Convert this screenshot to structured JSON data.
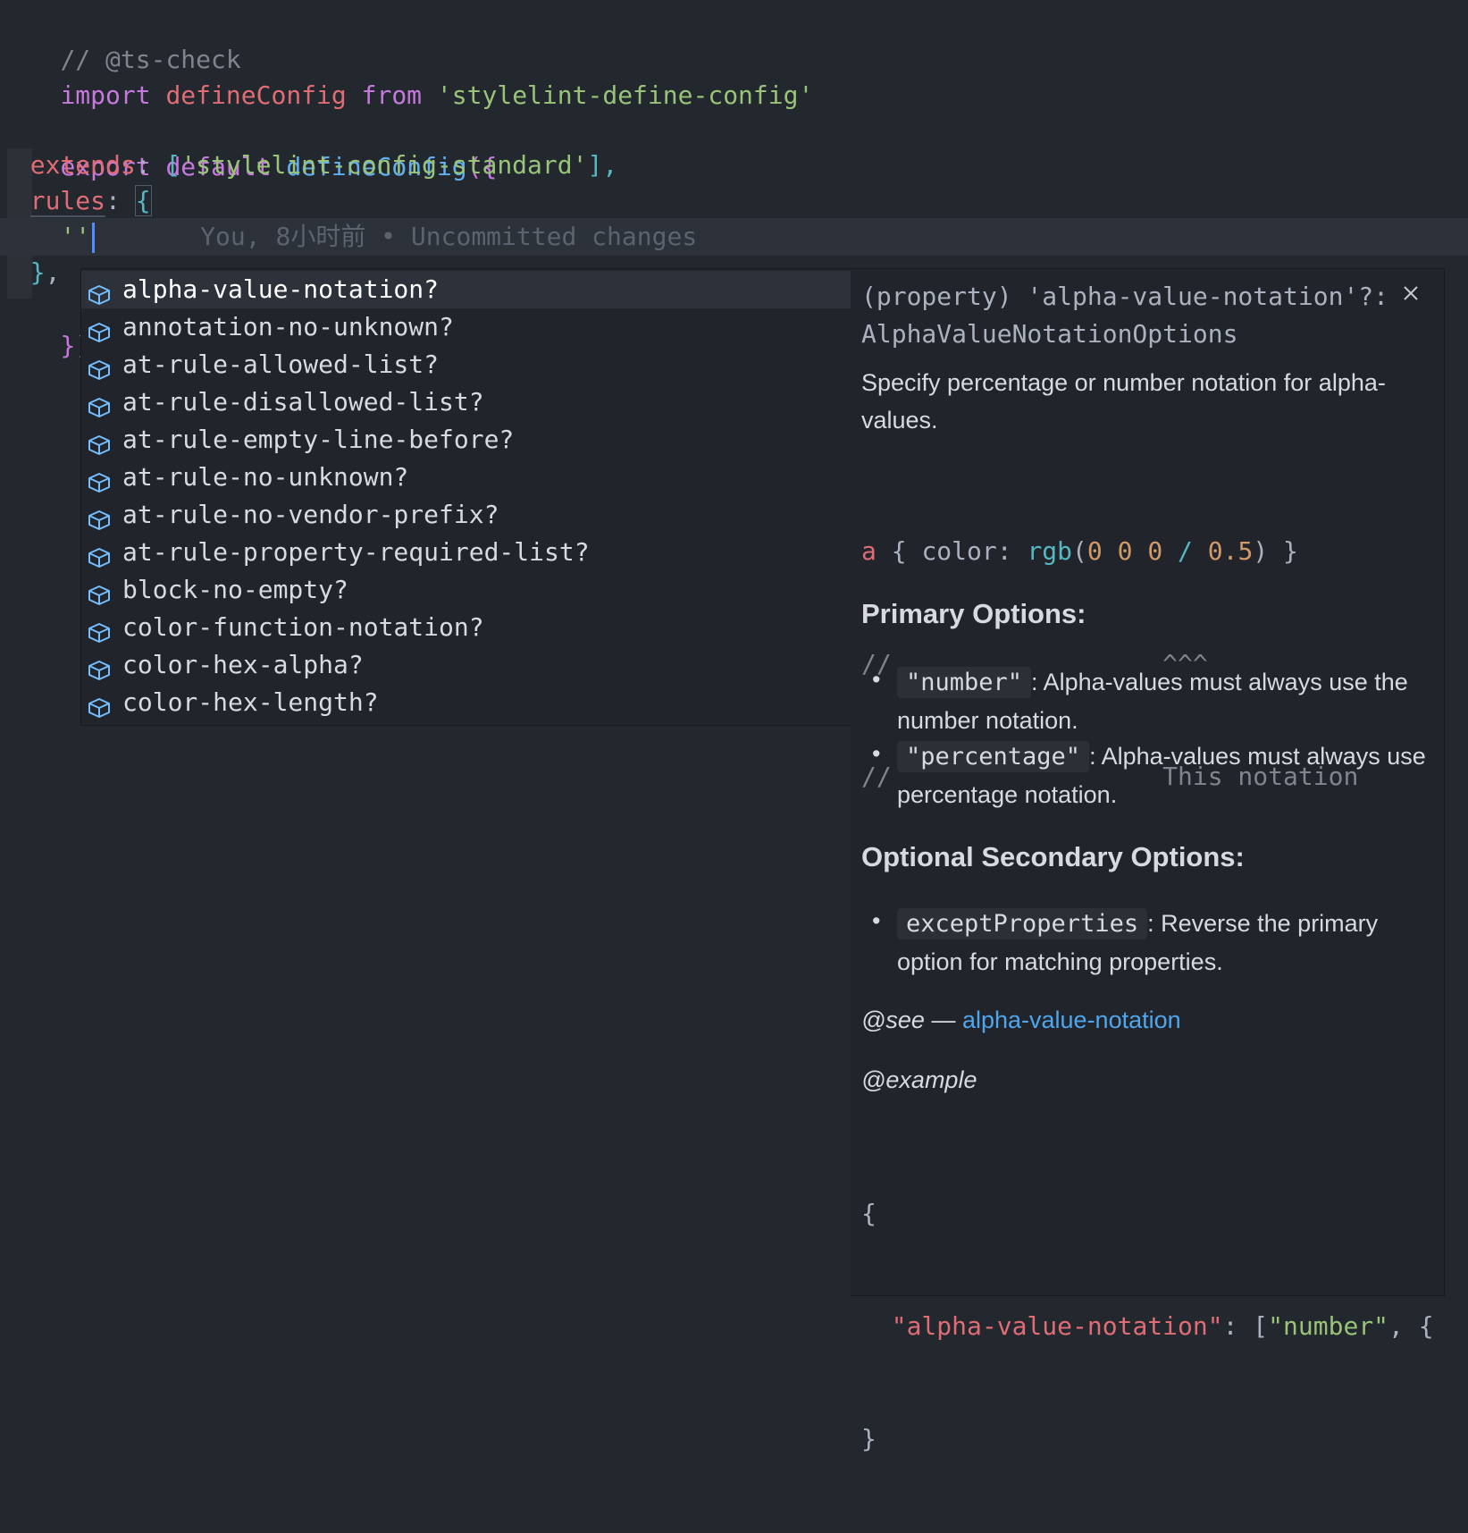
{
  "editor": {
    "line1": "// @ts-check",
    "line2": {
      "kw_import": "import",
      "ident": "defineConfig",
      "kw_from": "from",
      "module": "'stylelint-define-config'"
    },
    "line4": {
      "kw_export": "export",
      "kw_default": "default",
      "fn": "defineConfig",
      "open": "({"
    },
    "line5": {
      "prop": "extends",
      "colon": ":",
      "open": "[",
      "value": "'stylelint-config-standard'",
      "close": "],"
    },
    "line6": {
      "prop": "rules",
      "colon": ":",
      "brace": "{"
    },
    "line7": {
      "quotes": "''",
      "blame": "You, 8小时前 • Uncommitted changes"
    },
    "line8": {
      "brace": "}",
      "comma": ","
    },
    "line9": {
      "close": "})"
    }
  },
  "suggestions": [
    "alpha-value-notation?",
    "annotation-no-unknown?",
    "at-rule-allowed-list?",
    "at-rule-disallowed-list?",
    "at-rule-empty-line-before?",
    "at-rule-no-unknown?",
    "at-rule-no-vendor-prefix?",
    "at-rule-property-required-list?",
    "block-no-empty?",
    "color-function-notation?",
    "color-hex-alpha?",
    "color-hex-length?"
  ],
  "suggestion_icon": "cube-icon",
  "details": {
    "signature_line1": "(property) 'alpha-value-notation'?:",
    "signature_line2": "AlphaValueNotationOptions",
    "close_icon": "close-icon",
    "description": "Specify percentage or number notation for alpha-values.",
    "code_example": {
      "sel": "a",
      "open": " { ",
      "prop": "color",
      "colon": ": ",
      "fn": "rgb",
      "paren_open": "(",
      "n1": "0",
      "n2": "0",
      "n3": "0",
      "slash": "/",
      "alpha": "0.5",
      "paren_close": ")",
      "close": " }",
      "comment1": "//                  ^^^",
      "comment2": "//                  This notation"
    },
    "primary_heading": "Primary Options:",
    "primary_options": [
      {
        "code": "\"number\"",
        "text": ": Alpha-values must always use the number notation."
      },
      {
        "code": "\"percentage\"",
        "text": ": Alpha-values must always use percentage notation."
      }
    ],
    "secondary_heading": "Optional Secondary Options:",
    "secondary_options": [
      {
        "code": "exceptProperties",
        "text": ": Reverse the primary option for matching properties."
      }
    ],
    "see_label": "@see",
    "see_dash": " — ",
    "see_link": "alpha-value-notation",
    "example_label": "@example",
    "example_code": {
      "open": "{",
      "key": "\"alpha-value-notation\"",
      "colon": ": [",
      "value": "\"number\"",
      "rest": ", {",
      "close": "}"
    }
  }
}
